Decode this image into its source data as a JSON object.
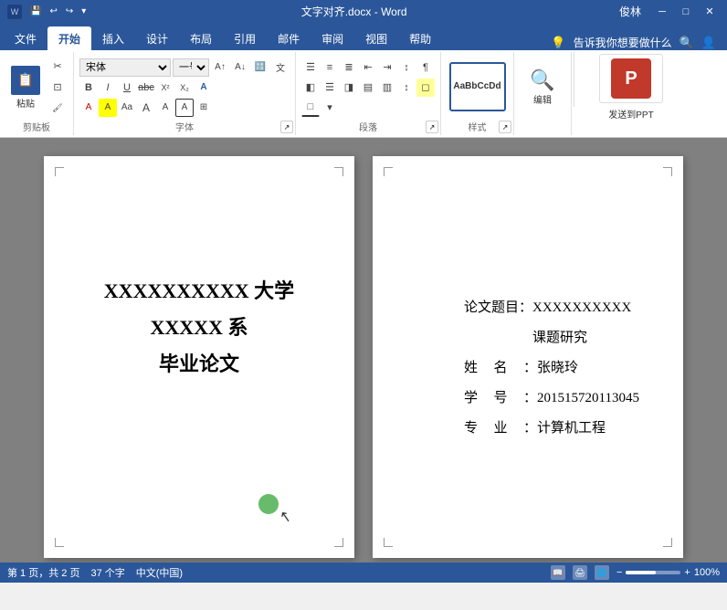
{
  "titleBar": {
    "title": "文字对齐.docx - Word",
    "user": "俊林",
    "quickAccess": [
      "save",
      "undo",
      "redo",
      "customize"
    ]
  },
  "ribbon": {
    "tabs": [
      "文件",
      "开始",
      "插入",
      "设计",
      "布局",
      "引用",
      "邮件",
      "审阅",
      "视图",
      "帮助"
    ],
    "activeTab": "开始",
    "groups": {
      "clipboard": {
        "label": "剪贴板",
        "paste": "粘贴",
        "cut": "✂",
        "copy": "⊡",
        "painter": "🖌"
      },
      "font": {
        "label": "字体",
        "fontName": "宋体",
        "fontSize": "一号",
        "expand": "▼"
      },
      "paragraph": {
        "label": "段落"
      },
      "style": {
        "label": "样式",
        "previewText": "AaBbCcDd"
      },
      "edit": {
        "label": "编辑"
      },
      "sendToPPT": {
        "label": "发送到PPT"
      }
    },
    "helpText": "告诉我你想要做什么",
    "helpPlaceholder": "告诉我你想要做什么"
  },
  "pages": {
    "page1": {
      "line1": "XXXXXXXXXX 大学",
      "line2": "XXXXX 系",
      "line3": "毕业论文"
    },
    "page2": {
      "rows": [
        {
          "label": "论文题目：",
          "value": "XXXXXXXXXX 课题研究"
        },
        {
          "label": "姓　名　：",
          "value": "张晓玲"
        },
        {
          "label": "学　号　：",
          "value": "201515720113045"
        },
        {
          "label": "专　业　：",
          "value": "计算机工程"
        }
      ]
    }
  },
  "statusBar": {
    "page": "第 1 页，共 2 页",
    "words": "37 个字",
    "lang": "中文(中国)",
    "zoom": "100%",
    "zoomLevel": 55
  }
}
